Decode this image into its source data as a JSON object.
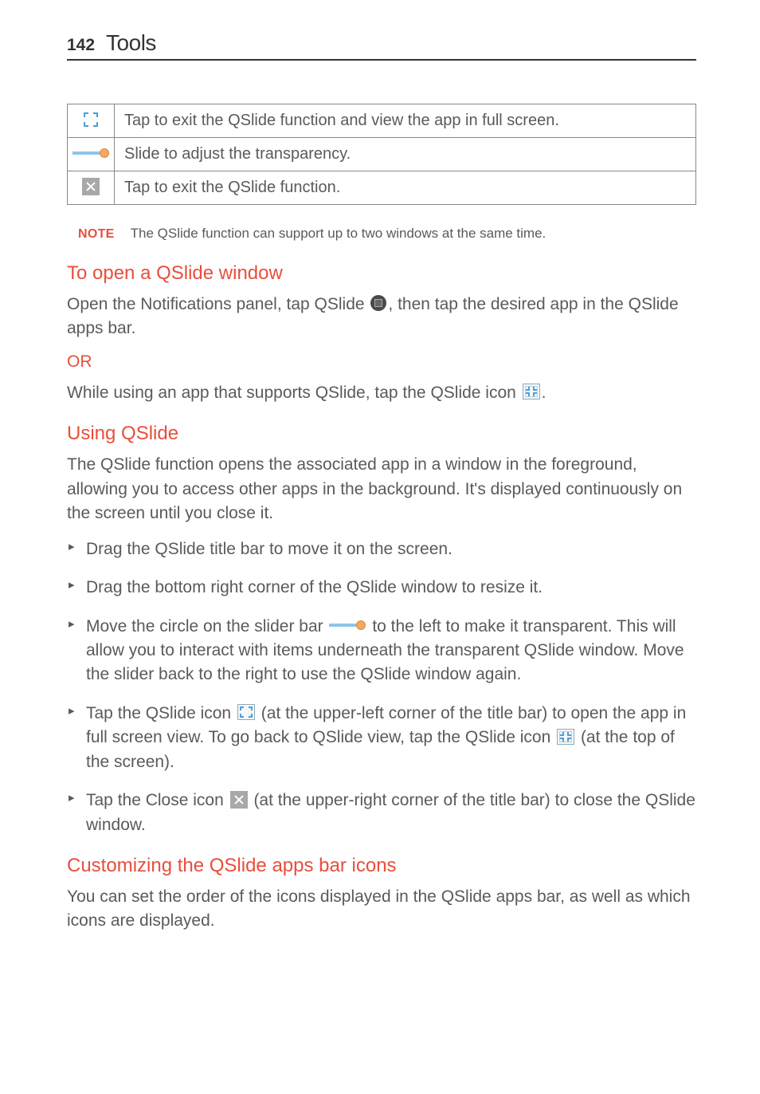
{
  "header": {
    "page_number": "142",
    "section": "Tools"
  },
  "table": {
    "r1": "Tap to exit the QSlide function and view the app in full screen.",
    "r2": "Slide to adjust the transparency.",
    "r3": "Tap to exit the QSlide function."
  },
  "note": {
    "label": "NOTE",
    "text": "The QSlide function can support up to two windows at the same time."
  },
  "open": {
    "heading": "To open a QSlide window",
    "p1a": "Open the Notifications panel, tap ",
    "p1bold": "QSlide",
    "p1b": ", then tap the desired app in the QSlide apps bar.",
    "or": "OR",
    "p2a": "While using an app that supports QSlide, tap the QSlide icon ",
    "p2b": "."
  },
  "using": {
    "heading": "Using QSlide",
    "intro": "The QSlide function opens the associated app in a window in the foreground, allowing you to access other apps in the background. It's displayed continuously on the screen until you close it.",
    "b1": "Drag the QSlide title bar to move it on the screen.",
    "b2": "Drag the bottom right corner of the QSlide window to resize it.",
    "b3a": "Move the circle on the slider bar ",
    "b3b": " to the left to make it transparent. This will allow you to interact with items underneath the transparent QSlide window. Move the slider back to the right to use the QSlide window again.",
    "b4a": "Tap the QSlide icon ",
    "b4b": " (at the upper-left corner of the title bar) to open the app in full screen view. To go back to QSlide view, tap the QSlide icon ",
    "b4c": " (at the top of the screen).",
    "b5a": "Tap the Close icon ",
    "b5b": " (at the upper-right corner of the title bar) to close the QSlide window."
  },
  "custom": {
    "heading": "Customizing the QSlide apps bar icons",
    "p": "You can set the order of the icons displayed in the QSlide apps bar, as well as which icons are displayed."
  }
}
